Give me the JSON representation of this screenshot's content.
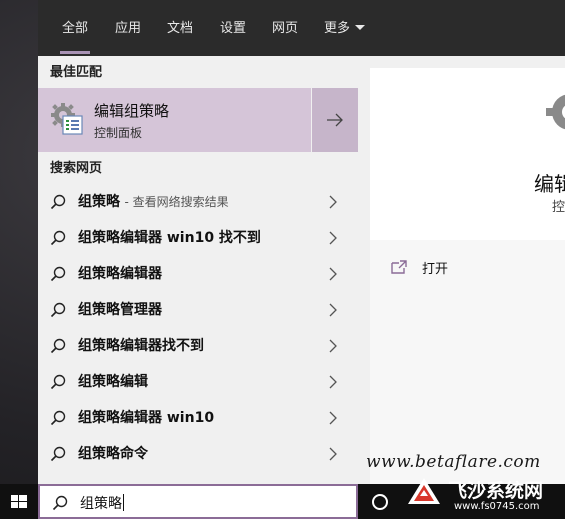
{
  "nav": {
    "tabs": [
      {
        "label": "全部"
      },
      {
        "label": "应用"
      },
      {
        "label": "文档"
      },
      {
        "label": "设置"
      },
      {
        "label": "网页"
      },
      {
        "label": "更多"
      }
    ],
    "active_tab": "全部"
  },
  "best_match": {
    "section_label": "最佳匹配",
    "title": "编辑组策略",
    "subtitle": "控制面板"
  },
  "web": {
    "section_label": "搜索网页",
    "first_suffix": "- 查看网络搜索结果",
    "results": [
      {
        "query": "组策略"
      },
      {
        "query": "组策略编辑器 win10 找不到"
      },
      {
        "query": "组策略编辑器"
      },
      {
        "query": "组策略管理器"
      },
      {
        "query": "组策略编辑器找不到"
      },
      {
        "query": "组策略编辑"
      },
      {
        "query": "组策略编辑器 win10"
      },
      {
        "query": "组策略命令"
      }
    ]
  },
  "preview": {
    "title": "编辑",
    "subtitle": "控",
    "open_label": "打开"
  },
  "search": {
    "value": "组策略"
  },
  "watermark": {
    "text": "www.betaflare.com",
    "brand": "飞沙系统网",
    "url": "www.fs0745.com"
  },
  "colors": {
    "accent": "#a892b4",
    "best_match_bg": "#d5c5d8",
    "search_border": "#8b6c97",
    "nav_bg": "#2b2b2b"
  },
  "icons": {
    "best_match": "group-policy-gear-icon",
    "result": "search-icon",
    "chevron": "chevron-right-icon",
    "open": "open-window-icon",
    "start": "windows-logo-icon",
    "cortana": "cortana-circle-icon"
  }
}
